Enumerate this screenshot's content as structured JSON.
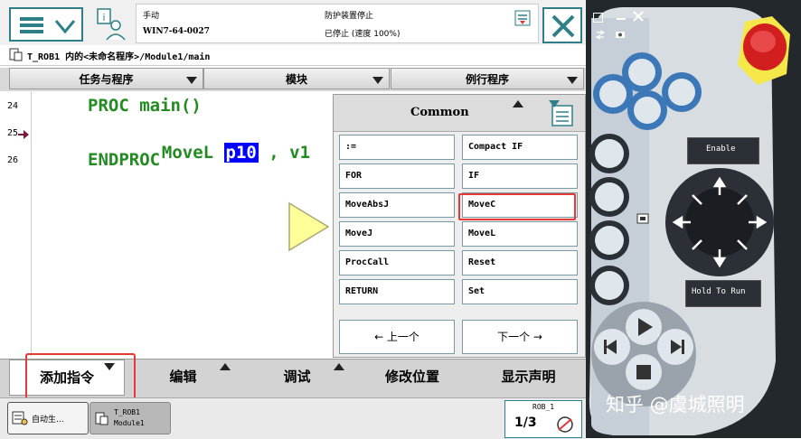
{
  "header": {
    "mode": "手动",
    "controller": "WIN7-64-0027",
    "safety": "防护装置停止",
    "status": "已停止 (速度 100%)"
  },
  "path": "T_ROB1 内的<未命名程序>/Module1/main",
  "tabs": [
    "任务与程序",
    "模块",
    "例行程序"
  ],
  "editor": {
    "lines": [
      {
        "num": "24",
        "code": "PROC main()"
      },
      {
        "num": "25",
        "code_pre": "MoveL ",
        "code_sel": "p10",
        "code_post": " , v1"
      },
      {
        "num": "26",
        "code": "ENDPROC"
      }
    ]
  },
  "popup": {
    "title": "Common",
    "instructions": [
      ":=",
      "Compact IF",
      "FOR",
      "IF",
      "MoveAbsJ",
      "MoveC",
      "MoveJ",
      "MoveL",
      "ProcCall",
      "Reset",
      "RETURN",
      "Set"
    ],
    "prev": "←  上一个",
    "next": "下一个  →"
  },
  "bottom": [
    "添加指令",
    "编辑",
    "调试",
    "修改位置",
    "显示声明"
  ],
  "taskbar": {
    "item1": "自动生...",
    "item2_line1": "T_ROB1",
    "item2_line2": "Module1",
    "rob_label": "ROB_1",
    "fraction": "1/3"
  },
  "pendant": {
    "enable": "Enable",
    "hold": "Hold To Run"
  },
  "watermark": "知乎 @虞城照明",
  "colors": {
    "accent": "#2e7f88",
    "highlight_red": "#e53935",
    "code_green": "#228b22",
    "selection_blue": "#0000ff"
  }
}
